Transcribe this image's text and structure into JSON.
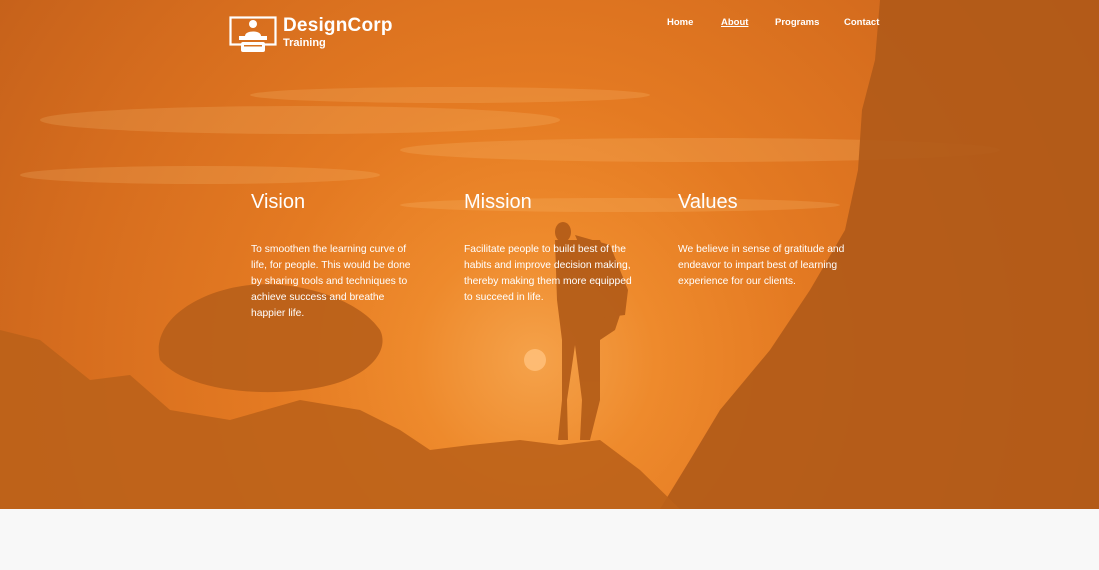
{
  "brand": {
    "name": "DesignCorp",
    "subtitle": "Training",
    "icon": "presenter-icon"
  },
  "nav": {
    "items": [
      {
        "label": "Home",
        "active": false
      },
      {
        "label": "About",
        "active": true
      },
      {
        "label": "Programs",
        "active": false
      },
      {
        "label": "Contact",
        "active": false
      }
    ]
  },
  "sections": [
    {
      "title": "Vision",
      "text": "To smoothen the learning curve of life, for people. This would be done by sharing tools and techniques to achieve success and breathe happier life."
    },
    {
      "title": "Mission",
      "text": "Facilitate people to build best of the habits and improve decision making, thereby making them more equipped to succeed in life."
    },
    {
      "title": "Values",
      "text": "We believe in sense of gratitude and endeavor to impart best of learning experience for our clients."
    }
  ],
  "colors": {
    "overlay": "#e07a22",
    "text": "#ffffff",
    "footer_bg": "#f8f8f8"
  }
}
